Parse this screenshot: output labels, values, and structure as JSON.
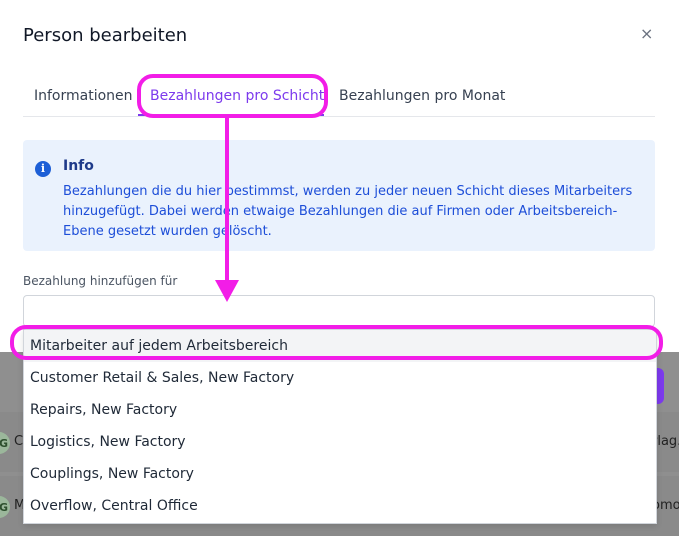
{
  "modal": {
    "title": "Person bearbeiten",
    "close_symbol": "×"
  },
  "tabs": [
    {
      "label": "Informationen",
      "active": false
    },
    {
      "label": "Bezahlungen pro Schicht",
      "active": true
    },
    {
      "label": "Bezahlungen pro Monat",
      "active": false
    }
  ],
  "info": {
    "icon": "info-icon",
    "title": "Info",
    "text": "Bezahlungen die du hier bestimmst, werden zu jeder neuen Schicht dieses Mitarbeiters hinzugefügt. Dabei werden etwaige Bezahlungen die auf Firmen oder Arbeitsbereich-Ebene gesetzt wurden gelöscht."
  },
  "field": {
    "label": "Bezahlung hinzufügen für",
    "value": ""
  },
  "dropdown": {
    "options": [
      "Mitarbeiter auf jedem Arbeitsbereich",
      "Customer Retail & Sales, New Factory",
      "Repairs, New Factory",
      "Logistics, New Factory",
      "Couplings, New Factory",
      "Overflow, Central Office"
    ],
    "highlighted_index": 0
  },
  "background": {
    "avatar_letter": "G",
    "row1_left": "C",
    "row1_right": "rlag.",
    "row2_left": "M",
    "row2_right": "omo"
  },
  "colors": {
    "accent": "#7c3aed",
    "annotation": "#f21de7",
    "info_bg": "#eaf2fd",
    "info_text": "#1d4ed8"
  }
}
